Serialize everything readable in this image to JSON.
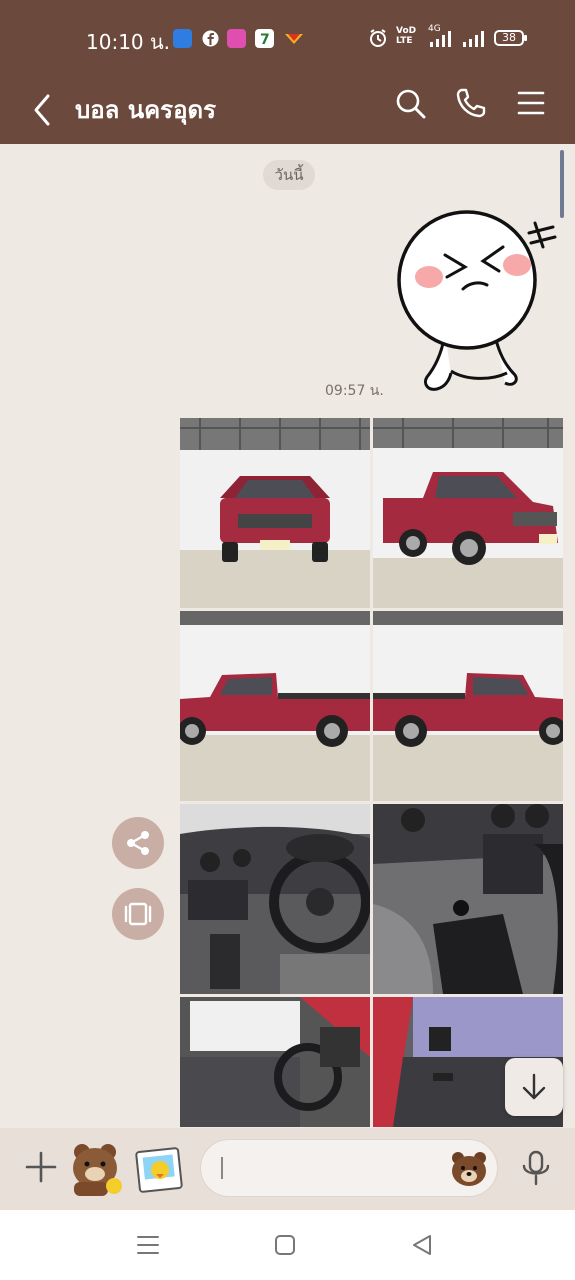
{
  "status_bar": {
    "time": "10:10 น.",
    "network_label": "VoD LTE",
    "network_type": "4G",
    "battery": "38"
  },
  "header": {
    "contact_name": "บอล นครอุดร",
    "colors": {
      "bar": "#6b4a3d"
    }
  },
  "chat": {
    "date_divider": "วันนี้",
    "sticker_name": "crying-laughing-face-sticker",
    "sticker_time": "09:57 น.",
    "photos": [
      {
        "name": "red-pickup-front-view"
      },
      {
        "name": "red-pickup-front-three-quarter"
      },
      {
        "name": "red-pickup-side-left"
      },
      {
        "name": "red-pickup-side-right"
      },
      {
        "name": "dashboard-interior"
      },
      {
        "name": "gear-shift-interior"
      },
      {
        "name": "door-interior-left"
      },
      {
        "name": "door-interior-right"
      }
    ]
  },
  "input_bar": {
    "placeholder": ""
  }
}
